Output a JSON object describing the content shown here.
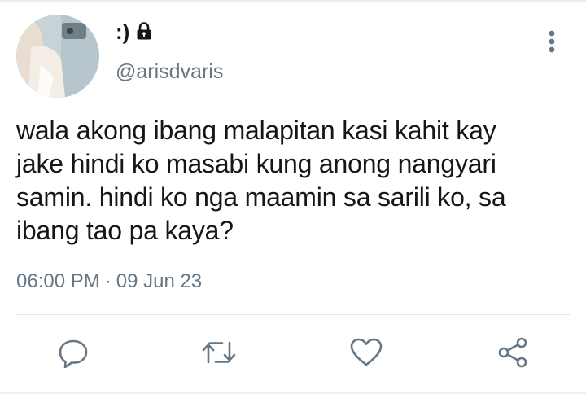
{
  "tweet": {
    "author": {
      "display_name": ":)",
      "handle": "@arisdvaris",
      "protected_icon": "lock-icon"
    },
    "text": "wala akong ibang malapitan kasi kahit kay\njake hindi ko masabi kung anong nangyari\nsamin. hindi ko nga maamin sa sarili ko, sa\nibang tao pa kaya?",
    "time": "06:00 PM",
    "separator": "·",
    "date": "09 Jun 23"
  },
  "menu": {
    "icon": "more-vertical-icon"
  },
  "actions": [
    {
      "name": "reply",
      "icon": "reply-icon"
    },
    {
      "name": "retweet",
      "icon": "retweet-icon"
    },
    {
      "name": "like",
      "icon": "heart-icon"
    },
    {
      "name": "share",
      "icon": "share-icon"
    }
  ],
  "colors": {
    "text_primary": "#14171a",
    "text_secondary": "#657786",
    "icon": "#657786",
    "divider": "#e1e8ed"
  }
}
